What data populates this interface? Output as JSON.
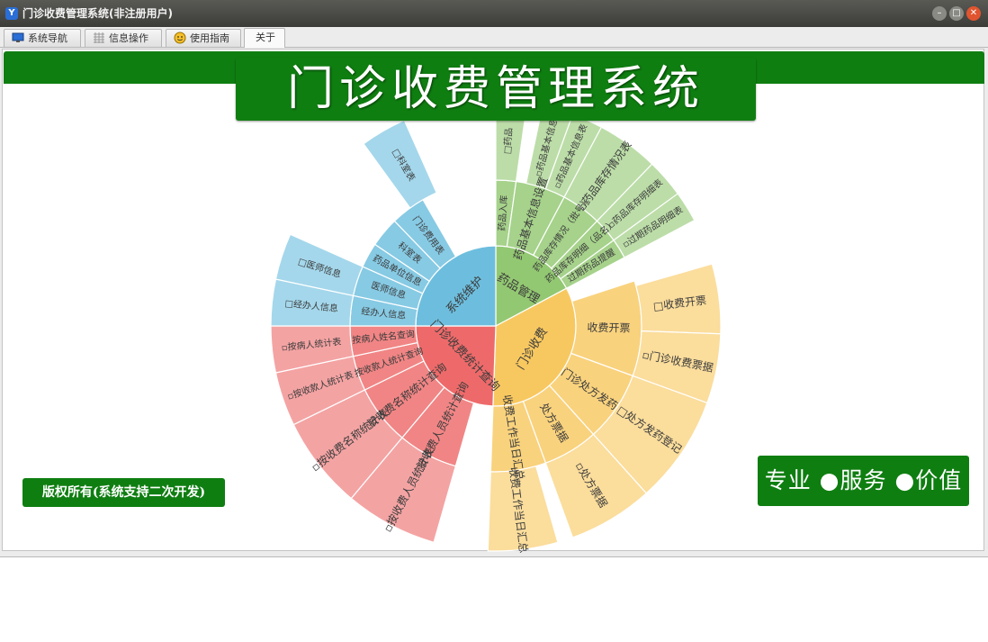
{
  "window": {
    "title": "门诊收费管理系统(非注册用户)",
    "controls": [
      "–",
      "□",
      "✕"
    ]
  },
  "tabs": [
    {
      "label": "系统导航",
      "icon": "monitor-icon"
    },
    {
      "label": "信息操作",
      "icon": "grid-icon"
    },
    {
      "label": "使用指南",
      "icon": "smiley-icon"
    },
    {
      "label": "关于",
      "icon": ""
    }
  ],
  "banner": {
    "title": "门诊收费管理系统"
  },
  "copyright": "版权所有(系统支持二次开发)",
  "slogan": "专业 ●服务 ●价值",
  "colors": {
    "brand_green": "#0f7e11",
    "sector_drug": "#93c872",
    "sector_clinic": "#f8c860",
    "sector_stats": "#ee6a6a",
    "sector_maint": "#6dbede"
  },
  "sunburst": {
    "sectors": [
      {
        "label": "药品管理",
        "color": "#93c872",
        "children": [
          {
            "label": "药品入库",
            "leaves": [
              "□药品",
              "▫药品入库"
            ]
          },
          {
            "label": "药品基本信息设置",
            "leaves": [
              "▫药品基本信息",
              "▫药品基本信息表"
            ]
          },
          {
            "label": "药品库存情况（批号）",
            "leaves": [
              "▫药品库存情况表"
            ]
          },
          {
            "label": "药品库存明细（品名）",
            "leaves": [
              "▫药品库存明细表"
            ]
          },
          {
            "label": "过期药品提醒",
            "leaves": [
              "▫过期药品明细表"
            ]
          }
        ]
      },
      {
        "label": "门诊收费",
        "color": "#f8c860",
        "children": [
          {
            "label": "收费开票",
            "leaves": [
              "□收费开票",
              "▫门诊收费票据"
            ]
          },
          {
            "label": "门诊处方发药",
            "leaves": [
              "□处方发药登记"
            ]
          },
          {
            "label": "处方票据",
            "leaves": [
              "▫处方票据"
            ]
          },
          {
            "label": "收费工作当日汇总",
            "leaves": [
              "收费工作当日汇总"
            ]
          }
        ]
      },
      {
        "label": "门诊收费统计查询",
        "color": "#ee6a6a",
        "children": [
          {
            "label": "按收费人员统计查询",
            "leaves": [
              "▫按收费人员统计表"
            ]
          },
          {
            "label": "按收费名称统计查询",
            "leaves": [
              "▫按收费名称统计表"
            ]
          },
          {
            "label": "按收款人统计查询",
            "leaves": [
              "▫按收款人统计表"
            ]
          },
          {
            "label": "按病人姓名查询",
            "leaves": [
              "▫按病人统计表"
            ]
          }
        ]
      },
      {
        "label": "系统维护",
        "color": "#6dbede",
        "children": [
          {
            "label": "经办人信息",
            "leaves": [
              "□经办人信息"
            ]
          },
          {
            "label": "医师信息",
            "leaves": [
              "□医师信息"
            ]
          },
          {
            "label": "药品单位信息",
            "leaves": []
          },
          {
            "label": "科室表",
            "leaves": []
          },
          {
            "label": "门诊费用表",
            "leaves": [
              "□科室表"
            ]
          }
        ]
      }
    ]
  }
}
